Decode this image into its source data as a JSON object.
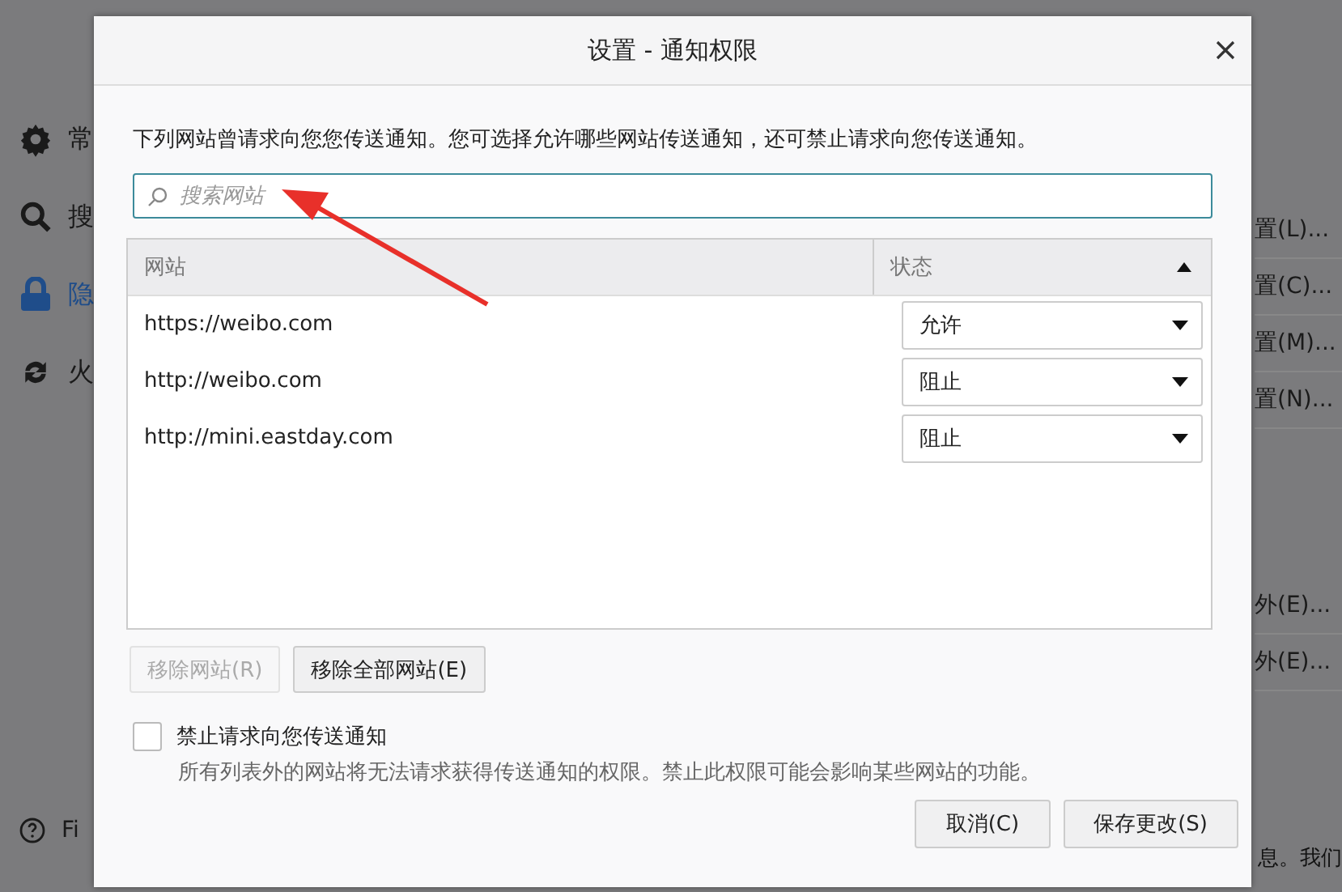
{
  "background": {
    "sidebar": [
      {
        "label": "常",
        "selected": false
      },
      {
        "label": "搜",
        "selected": false
      },
      {
        "label": "隐",
        "selected": true
      },
      {
        "label": "火",
        "selected": false
      }
    ],
    "footer_link": "Fi",
    "settings_buttons": [
      "置(L)...",
      "置(C)...",
      "置(M)...",
      "置(N)...",
      "外(E)...",
      "外(E)..."
    ],
    "bottom_text": "息。我们"
  },
  "dialog": {
    "title": "设置 - 通知权限",
    "description": "下列网站曾请求向您您传送通知。您可选择允许哪些网站传送通知，还可禁止请求向您传送通知。",
    "search": {
      "placeholder": "搜索网站"
    },
    "table": {
      "columns": [
        "网站",
        "状态"
      ],
      "rows": [
        {
          "site": "https://weibo.com",
          "status": "允许"
        },
        {
          "site": "http://weibo.com",
          "status": "阻止"
        },
        {
          "site": "http://mini.eastday.com",
          "status": "阻止"
        }
      ]
    },
    "remove_buttons": [
      {
        "label": "移除网站(R)",
        "disabled": true
      },
      {
        "label": "移除全部网站(E)",
        "disabled": false
      }
    ],
    "block_option": {
      "label": "禁止请求向您传送通知",
      "checked": false,
      "note": "所有列表外的网站将无法请求获得传送通知的权限。禁止此权限可能会影响某些网站的功能。"
    },
    "buttons": [
      "取消(C)",
      "保存更改(S)"
    ]
  }
}
